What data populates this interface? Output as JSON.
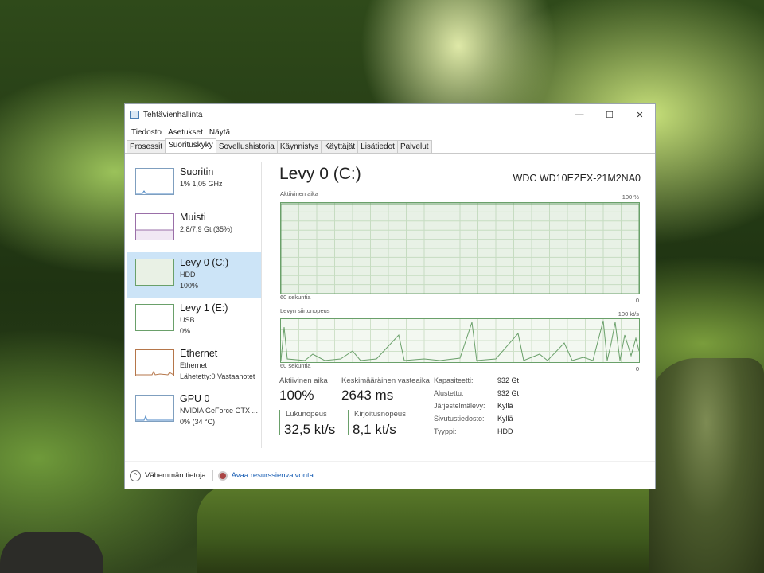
{
  "window": {
    "title": "Tehtävienhallinta",
    "controls": {
      "minimize": "—",
      "maximize": "☐",
      "close": "✕"
    }
  },
  "menu": [
    "Tiedosto",
    "Asetukset",
    "Näytä"
  ],
  "tabs": [
    {
      "label": "Prosessit",
      "active": false
    },
    {
      "label": "Suorituskyky",
      "active": true
    },
    {
      "label": "Sovellushistoria",
      "active": false
    },
    {
      "label": "Käynnistys",
      "active": false
    },
    {
      "label": "Käyttäjät",
      "active": false
    },
    {
      "label": "Lisätiedot",
      "active": false
    },
    {
      "label": "Palvelut",
      "active": false
    }
  ],
  "sidebar": {
    "items": [
      {
        "name": "Suoritin",
        "sub1": "1%  1,05 GHz",
        "sub2": ""
      },
      {
        "name": "Muisti",
        "sub1": "2,8/7,9 Gt (35%)",
        "sub2": ""
      },
      {
        "name": "Levy 0 (C:)",
        "sub1": "HDD",
        "sub2": "100%"
      },
      {
        "name": "Levy 1 (E:)",
        "sub1": "USB",
        "sub2": "0%"
      },
      {
        "name": "Ethernet",
        "sub1": "Ethernet",
        "sub2": "Lähetetty:0  Vastaanotet"
      },
      {
        "name": "GPU 0",
        "sub1": "NVIDIA GeForce GTX ...",
        "sub2": "0%  (34 °C)"
      }
    ],
    "active_index": 2
  },
  "main": {
    "title": "Levy 0 (C:)",
    "model": "WDC WD10EZEX-21M2NA0",
    "graph1": {
      "label": "Aktiivinen aika",
      "max": "100 %",
      "time": "60 sekuntia",
      "min": "0"
    },
    "graph2": {
      "label": "Levyn siirtonopeus",
      "max": "100 kt/s",
      "time": "60 sekuntia",
      "min": "0"
    }
  },
  "stats": {
    "active_time_label": "Aktiivinen aika",
    "active_time_value": "100%",
    "response_label": "Keskimääräinen vasteaika",
    "response_value": "2643 ms",
    "read_label": "Lukunopeus",
    "read_value": "32,5 kt/s",
    "write_label": "Kirjoitusnopeus",
    "write_value": "8,1 kt/s"
  },
  "properties": [
    {
      "key": "Kapasiteetti:",
      "value": "932 Gt"
    },
    {
      "key": "Alustettu:",
      "value": "932 Gt"
    },
    {
      "key": "Järjestelmälevy:",
      "value": "Kyllä"
    },
    {
      "key": "Sivutustiedosto:",
      "value": "Kyllä"
    },
    {
      "key": "Tyyppi:",
      "value": "HDD"
    }
  ],
  "footer": {
    "fewer_details": "Vähemmän tietoja",
    "resource_monitor": "Avaa resurssienvalvonta"
  },
  "colors": {
    "disk_green": "#6aa06a",
    "selection_blue": "#cce4f7",
    "link_blue": "#1a5fb4"
  }
}
